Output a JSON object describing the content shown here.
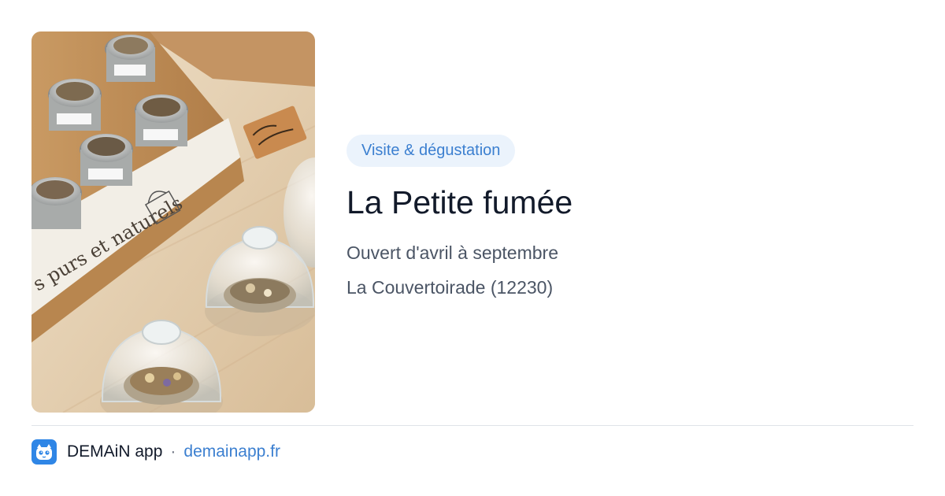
{
  "card": {
    "image_alt": "Bocaux et cloches en verre de thé et épices sur un présentoir en bois",
    "image_label_text": "s purs et naturels",
    "tag": "Visite & dégustation",
    "title": "La Petite fumée",
    "opening": "Ouvert d'avril à septembre",
    "location": "La Couvertoirade (12230)"
  },
  "footer": {
    "app_icon": "demain-app-logo-icon",
    "app_name": "DEMAiN app",
    "separator": "·",
    "link": "demainapp.fr"
  },
  "colors": {
    "accent": "#3b7fd0",
    "tag_background": "#ebf3fc",
    "title": "#121a2a",
    "body_text": "#4b5565",
    "app_icon_background": "#2f86e6"
  }
}
